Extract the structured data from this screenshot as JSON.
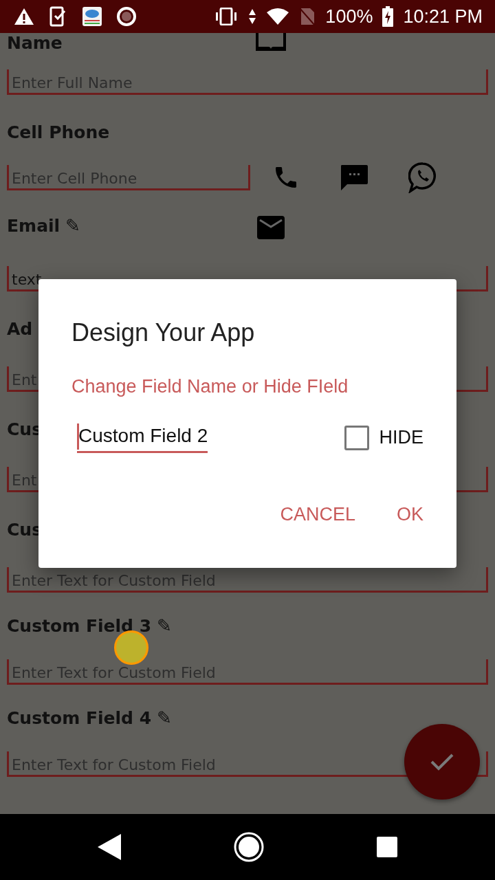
{
  "status_bar": {
    "battery": "100%",
    "time": "10:21 PM"
  },
  "form": [
    {
      "kind": "name_label",
      "label": "Name"
    },
    {
      "kind": "field",
      "placeholder": "Enter Full Name"
    },
    {
      "kind": "label",
      "label": "Cell Phone"
    },
    {
      "kind": "phone_field",
      "placeholder": "Enter Cell Phone"
    },
    {
      "kind": "email_label",
      "label": "Email",
      "edit": "✎"
    },
    {
      "kind": "field",
      "value": "text"
    },
    {
      "kind": "label",
      "label": "Ad"
    },
    {
      "kind": "field",
      "placeholder": "Ent"
    },
    {
      "kind": "label",
      "label": "Cus"
    },
    {
      "kind": "field",
      "placeholder": "Ent"
    },
    {
      "kind": "label",
      "label": "Cus"
    },
    {
      "kind": "field",
      "placeholder": "Enter Text for Custom Field"
    },
    {
      "kind": "label",
      "label": "Custom Field 3",
      "edit": "✎"
    },
    {
      "kind": "field",
      "placeholder": "Enter Text for Custom Field"
    },
    {
      "kind": "label",
      "label": "Custom Field 4",
      "edit": "✎"
    },
    {
      "kind": "field",
      "placeholder": "Enter Text for Custom Field"
    }
  ],
  "dialog": {
    "title": "Design Your App",
    "subtitle": "Change Field Name or Hide FIeld",
    "field_value": "Custom Field 2",
    "hide": {
      "label": "HIDE",
      "checked": false
    },
    "buttons": [
      "CANCEL",
      "OK"
    ]
  }
}
